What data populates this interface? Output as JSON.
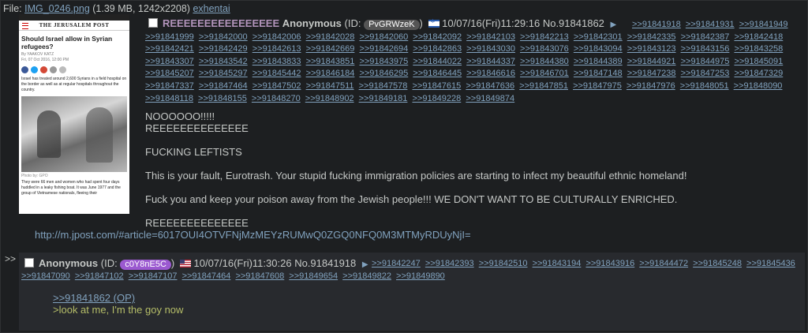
{
  "file": {
    "prefix": "File: ",
    "name": "IMG_0246.png",
    "meta": " (1.39 MB, 1242x2208) ",
    "source": "exhentai"
  },
  "thumbnail": {
    "masthead": "THE JERUSALEM POST",
    "headline": "Should Israel allow in Syrian refugees?",
    "byline": "By YAAKOV KATZ",
    "date": "Fri, 07 Oct 2016, 12:00 PM",
    "lead": "Israel has treated around 2,600 Syrians in a field hospital on the border as well as at regular hospitals throughout the country.",
    "credit": "Photo by: GPO",
    "caption": "They were 66 men and women who had spent four days huddled in a leaky fishing boat. It was June 1977 and the group of Vietnamese nationals, fleeing their"
  },
  "op": {
    "subject": "REEEEEEEEEEEEEEEE",
    "name": "Anonymous",
    "id_label": "(ID: ",
    "id": "PvGRWzeK",
    "id_close": ")",
    "date": "10/07/16(Fri)11:29:16",
    "number": "No.91841862",
    "backlinks": [
      ">>91841918",
      ">>91841931",
      ">>91841949",
      ">>91841999",
      ">>91842000",
      ">>91842006",
      ">>91842028",
      ">>91842060",
      ">>91842092",
      ">>91842103",
      ">>91842213",
      ">>91842301",
      ">>91842335",
      ">>91842387",
      ">>91842418",
      ">>91842421",
      ">>91842429",
      ">>91842613",
      ">>91842669",
      ">>91842694",
      ">>91842863",
      ">>91843030",
      ">>91843076",
      ">>91843094",
      ">>91843123",
      ">>91843156",
      ">>91843258",
      ">>91843307",
      ">>91843542",
      ">>91843833",
      ">>91843851",
      ">>91843975",
      ">>91844022",
      ">>91844337",
      ">>91844380",
      ">>91844389",
      ">>91844921",
      ">>91844975",
      ">>91845091",
      ">>91845207",
      ">>91845297",
      ">>91845442",
      ">>91846184",
      ">>91846295",
      ">>91846445",
      ">>91846616",
      ">>91846701",
      ">>91847148",
      ">>91847238",
      ">>91847253",
      ">>91847329",
      ">>91847337",
      ">>91847464",
      ">>91847502",
      ">>91847511",
      ">>91847578",
      ">>91847615",
      ">>91847636",
      ">>91847851",
      ">>91847975",
      ">>91847976",
      ">>91848051",
      ">>91848090",
      ">>91848118",
      ">>91848155",
      ">>91848270",
      ">>91848902",
      ">>91849181",
      ">>91849228",
      ">>91849874"
    ],
    "body": [
      "NOOOOOO!!!!!",
      "REEEEEEEEEEEEEE",
      "",
      "FUCKING LEFTISTS",
      "",
      "This is your fault, Eurotrash. Your stupid fucking immigration policies are starting to infect my beautiful ethnic homeland!",
      "",
      "Fuck you and keep your poison away from the Jewish people!!! WE DON'T WANT TO BE CULTURALLY ENRICHED.",
      "",
      "REEEEEEEEEEEEEE"
    ],
    "link": "http://m.jpost.com/#article=6017OUI4OTVFNjMzMEYzRUMwQ0ZGQ0NFQ0M3MTMyRDUyNjI="
  },
  "reply": {
    "marker": ">>",
    "name": "Anonymous",
    "id_label": "(ID: ",
    "id": "c0Y8nE5C",
    "id_close": ")",
    "date": "10/07/16(Fri)11:30:26",
    "number": "No.91841918",
    "backlinks": [
      ">>91842247",
      ">>91842393",
      ">>91842510",
      ">>91843194",
      ">>91843916",
      ">>91844472",
      ">>91845248",
      ">>91845436",
      ">>91847090",
      ">>91847102",
      ">>91847107",
      ">>91847464",
      ">>91847608",
      ">>91849654",
      ">>91849822",
      ">>91849890"
    ],
    "quotelink": ">>91841862 (OP)",
    "greentext": ">look at me, I'm the goy now"
  },
  "colors": {
    "background": "#1d1f21",
    "reply_background": "#282a2e",
    "link": "#81a2be",
    "subject": "#b294bb",
    "greentext": "#b5bd68"
  }
}
